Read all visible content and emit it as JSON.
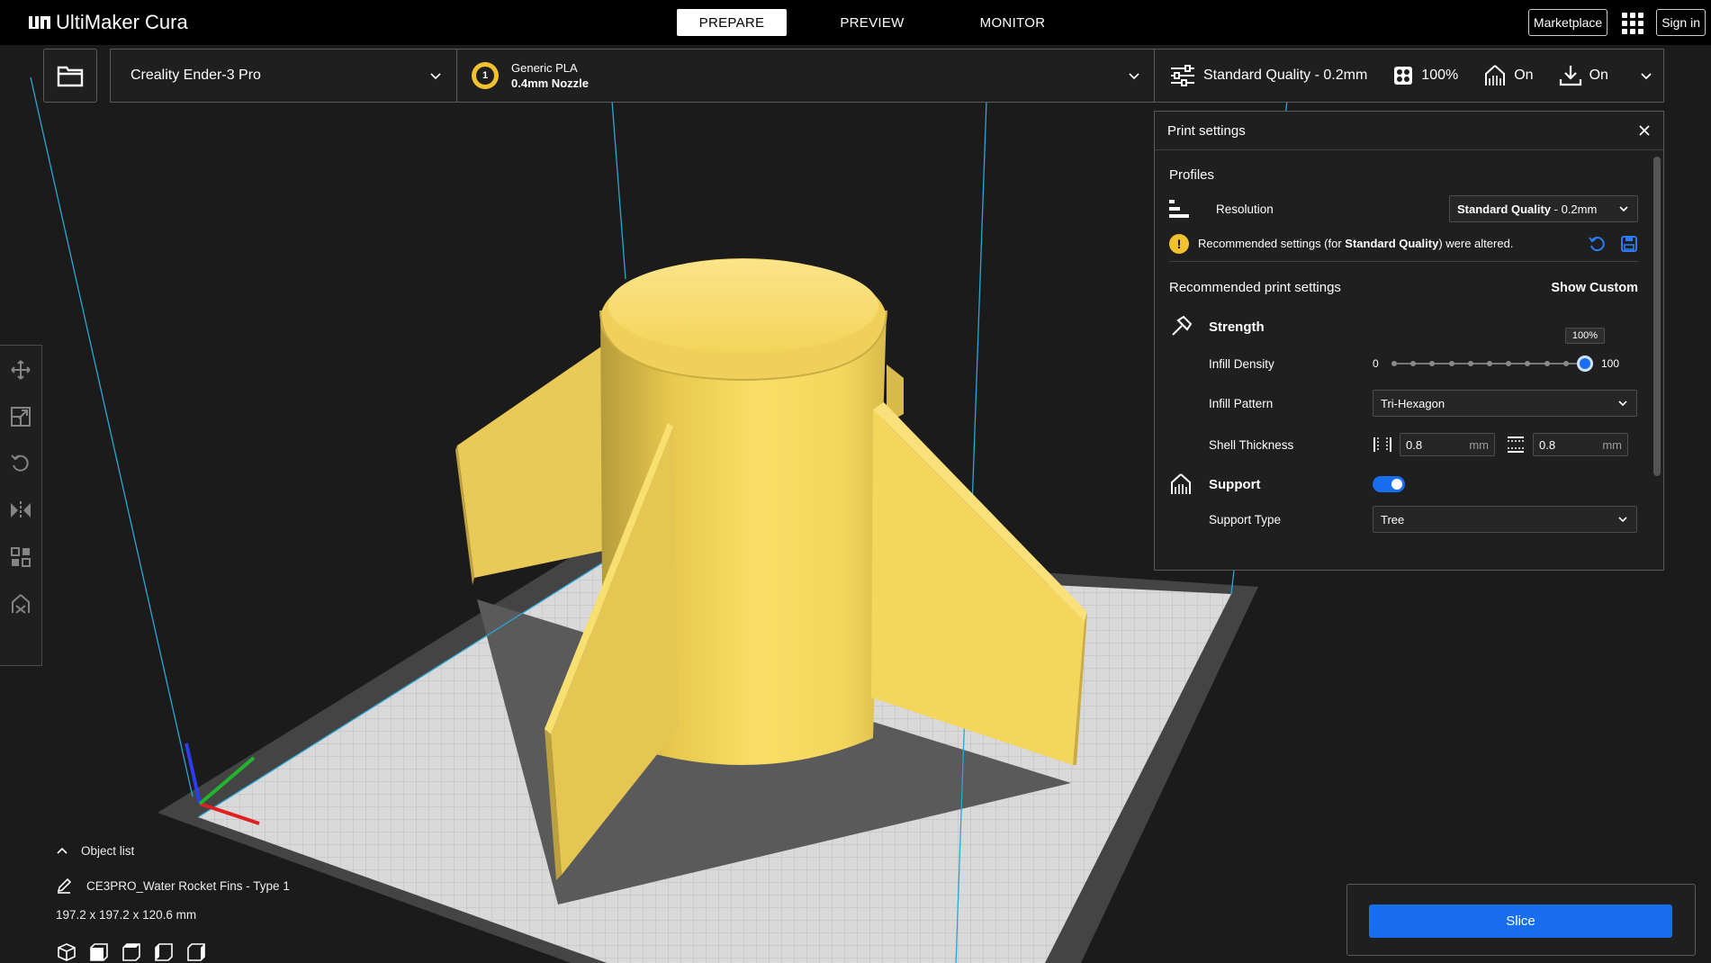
{
  "app": {
    "brand": "UltiMaker Cura",
    "tabs": [
      {
        "label": "PREPARE",
        "active": true
      },
      {
        "label": "PREVIEW",
        "active": false
      },
      {
        "label": "MONITOR",
        "active": false
      }
    ],
    "marketplace_label": "Marketplace",
    "signin_label": "Sign in"
  },
  "printer": {
    "machine": "Creality Ender-3 Pro",
    "extruder_number": "1",
    "material": "Generic PLA",
    "nozzle": "0.4mm Nozzle"
  },
  "settings_bar": {
    "profile": "Standard Quality - 0.2mm",
    "infill": "100%",
    "support": "On",
    "adhesion": "On"
  },
  "print_settings": {
    "title": "Print settings",
    "profiles_label": "Profiles",
    "resolution_label": "Resolution",
    "resolution_value_bold": "Standard Quality",
    "resolution_value_rest": " - 0.2mm",
    "altered_prefix": "Recommended settings (for ",
    "altered_bold": "Standard Quality",
    "altered_suffix": ") were altered.",
    "recommended_label": "Recommended print settings",
    "show_custom_label": "Show Custom",
    "strength_label": "Strength",
    "infill_density_label": "Infill Density",
    "infill_min": "0",
    "infill_max": "100",
    "infill_value_label": "100%",
    "infill_value": 100,
    "infill_pattern_label": "Infill Pattern",
    "infill_pattern_value": "Tri-Hexagon",
    "shell_thickness_label": "Shell Thickness",
    "wall_thickness": "0.8",
    "top_bottom_thickness": "0.8",
    "unit_mm": "mm",
    "support_label": "Support",
    "support_enabled": true,
    "support_type_label": "Support Type",
    "support_type_value": "Tree"
  },
  "object_list": {
    "header": "Object list",
    "item_name": "CE3PRO_Water Rocket Fins - Type 1",
    "dimensions": "197.2 x 197.2 x 120.6 mm"
  },
  "slice": {
    "label": "Slice"
  },
  "colors": {
    "accent": "#196ef0",
    "model_yellow": "#f7d35a",
    "warning": "#f2c12e"
  }
}
